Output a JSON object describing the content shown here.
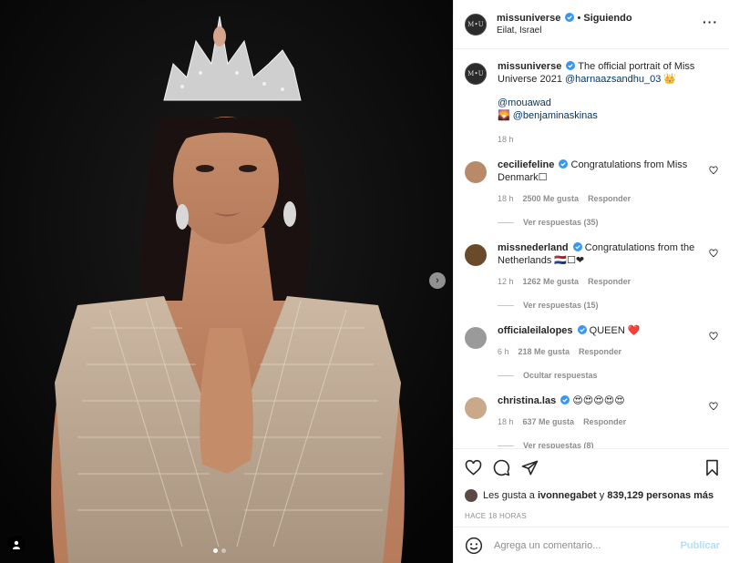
{
  "post": {
    "username": "missuniverse",
    "follow_sep": "•",
    "follow_label": "Siguiendo",
    "location": "Eilat, Israel",
    "more_icon": "more-horizontal-icon",
    "avatar_text": "M•U"
  },
  "caption": {
    "username": "missuniverse",
    "text": "The official portrait of Miss Universe 2021",
    "mention": "@harnaazsandhu_03",
    "emoji": "👑",
    "credit1": "@mouawad",
    "credit2_icon": "🌄",
    "credit2": "@benjaminaskinas",
    "time": "18 h"
  },
  "comments": [
    {
      "username": "ceciliefeline",
      "text": "Congratulations from Miss Denmark☐",
      "time": "18 h",
      "likes": "2500 Me gusta",
      "reply": "Responder",
      "replies": "Ver respuestas (35)",
      "avatar_color": "#b88a6a"
    },
    {
      "username": "missnederland",
      "text": "Congratulations from the Netherlands 🇳🇱☐❤",
      "time": "12 h",
      "likes": "1262 Me gusta",
      "reply": "Responder",
      "replies": "Ver respuestas (15)",
      "avatar_color": "#6b4a2c"
    },
    {
      "username": "officialeilalopes",
      "text": "QUEEN ❤️",
      "time": "6 h",
      "likes": "218 Me gusta",
      "reply": "Responder",
      "replies": "Ocultar respuestas",
      "avatar_color": "#9a9a9a"
    },
    {
      "username": "christina.las",
      "text": "😍😍😍😍😍",
      "time": "18 h",
      "likes": "637 Me gusta",
      "reply": "Responder",
      "replies": "Ver respuestas (8)",
      "avatar_color": "#c9a98a"
    }
  ],
  "likes": {
    "prefix": "Les gusta a",
    "user": "ivonnegabet",
    "middle": "y",
    "count": "839,129 personas más"
  },
  "time_ago": "HACE 18 HORAS",
  "comment_box": {
    "placeholder": "Agrega un comentario...",
    "publish": "Publicar"
  },
  "colors": {
    "link": "#00376b",
    "verified": "#3897f0",
    "muted": "#8e8e8e",
    "publish_disabled": "#b2dffc"
  },
  "icons": [
    "heart-icon",
    "comment-icon",
    "share-icon",
    "bookmark-icon",
    "emoji-icon",
    "verified-icon",
    "next-arrow-icon",
    "user-tag-icon"
  ]
}
